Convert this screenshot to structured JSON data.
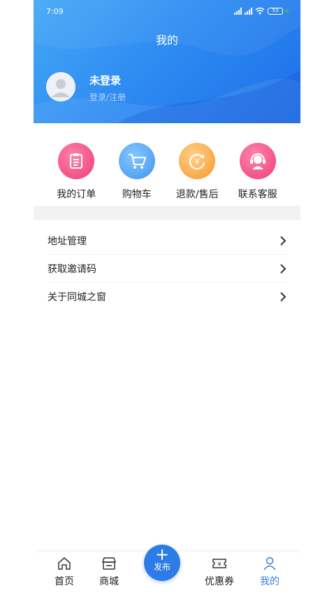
{
  "status_bar": {
    "time": "7:09",
    "battery": "53"
  },
  "header": {
    "title": "我的"
  },
  "user": {
    "name": "未登录",
    "login_link": "登录/注册"
  },
  "shortcuts": [
    {
      "label": "我的订单",
      "icon": "clipboard-icon",
      "color": "#f0487f"
    },
    {
      "label": "购物车",
      "icon": "cart-icon",
      "color": "#4aa3f2"
    },
    {
      "label": "退款/售后",
      "icon": "refund-icon",
      "color": "#f9a336"
    },
    {
      "label": "联系客服",
      "icon": "headset-icon",
      "color": "#f0487f"
    }
  ],
  "menu": [
    {
      "label": "地址管理"
    },
    {
      "label": "获取邀请码"
    },
    {
      "label": "关于同城之窗"
    }
  ],
  "tabbar": {
    "home": "首页",
    "mall": "商城",
    "publish": "发布",
    "coupons": "优惠券",
    "mine": "我的",
    "active_color": "#3a7de5"
  }
}
